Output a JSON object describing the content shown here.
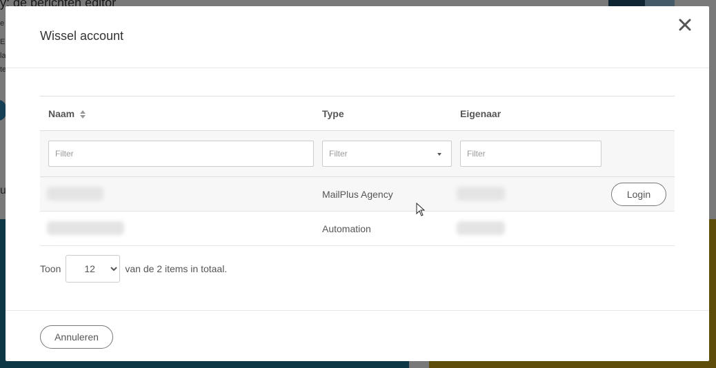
{
  "background": {
    "title_fragment": "y; de berichten editor",
    "side_fragments": [
      "e",
      "E",
      "la",
      "te",
      "u"
    ]
  },
  "modal": {
    "title": "Wissel account",
    "close_icon": "close-icon",
    "table": {
      "columns": [
        "Naam",
        "Type",
        "Eigenaar"
      ],
      "filters": {
        "naam_placeholder": "Filter",
        "type_selected": "Filter",
        "eigenaar_placeholder": "Filter"
      },
      "rows": [
        {
          "type": "MailPlus Agency",
          "action": "Login"
        },
        {
          "type": "Automation",
          "action": ""
        }
      ]
    },
    "pager": {
      "show_label": "Toon",
      "page_size": "12",
      "page_size_options": [
        "12"
      ],
      "total_text": "van de 2 items in totaal."
    },
    "footer": {
      "cancel_label": "Annuleren"
    }
  }
}
